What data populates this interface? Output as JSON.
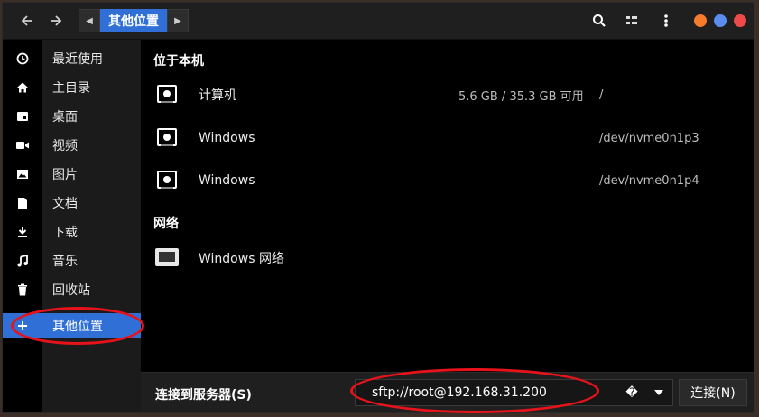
{
  "header": {
    "path_current": "其他位置"
  },
  "sidebar": {
    "items": [
      {
        "label": "最近使用",
        "icon": "clock-icon"
      },
      {
        "label": "主目录",
        "icon": "home-icon"
      },
      {
        "label": "桌面",
        "icon": "desktop-icon"
      },
      {
        "label": "视频",
        "icon": "video-icon"
      },
      {
        "label": "图片",
        "icon": "image-icon"
      },
      {
        "label": "文档",
        "icon": "document-icon"
      },
      {
        "label": "下载",
        "icon": "download-icon"
      },
      {
        "label": "音乐",
        "icon": "music-icon"
      },
      {
        "label": "回收站",
        "icon": "trash-icon"
      },
      {
        "label": "其他位置",
        "icon": "plus-icon"
      }
    ]
  },
  "main": {
    "section_local": "位于本机",
    "local_items": [
      {
        "name": "计算机",
        "space": "5.6 GB / 35.3 GB 可用",
        "path": "/"
      },
      {
        "name": "Windows",
        "space": "",
        "path": "/dev/nvme0n1p3"
      },
      {
        "name": "Windows",
        "space": "",
        "path": "/dev/nvme0n1p4"
      }
    ],
    "section_network": "网络",
    "network_items": [
      {
        "name": "Windows 网络"
      }
    ]
  },
  "bottom": {
    "connect_label": "连接到服务器(S)",
    "address_value": "sftp://root@192.168.31.200",
    "help_glyph": "�",
    "connect_button": "连接(N)"
  },
  "colors": {
    "accent": "#2f6fd6",
    "annotation": "#e8121b",
    "dot_orange": "#f57c2b",
    "dot_blue": "#5b8def",
    "dot_red": "#ef4a4a"
  }
}
